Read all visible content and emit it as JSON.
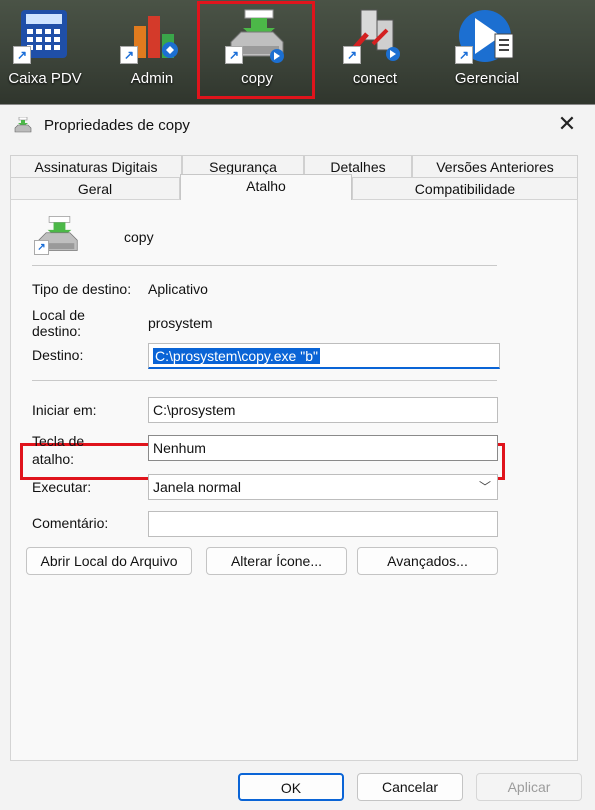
{
  "desktop": {
    "icons": [
      {
        "label": "Caixa PDV",
        "icon": "cash-register-icon"
      },
      {
        "label": "Admin",
        "icon": "admin-chart-icon"
      },
      {
        "label": "copy",
        "icon": "copy-app-icon"
      },
      {
        "label": "conect",
        "icon": "conect-app-icon"
      },
      {
        "label": "Gerencial",
        "icon": "gerencial-app-icon"
      }
    ]
  },
  "dialog": {
    "title": "Propriedades de copy",
    "close": "✕",
    "tabs_row1": [
      "Assinaturas Digitais",
      "Segurança",
      "Detalhes",
      "Versões Anteriores"
    ],
    "tabs_row2": [
      "Geral",
      "Atalho",
      "Compatibilidade"
    ],
    "active_tab": "Atalho",
    "app_name": "copy",
    "tipo_label": "Tipo de destino:",
    "tipo_value": "Aplicativo",
    "local_label1": "Local de",
    "local_label2": "destino:",
    "local_value": "prosystem",
    "destino_label": "Destino:",
    "destino_value": "C:\\prosystem\\copy.exe \"b\"",
    "iniciar_label": "Iniciar em:",
    "iniciar_value": "C:\\prosystem",
    "tecla_label1": "Tecla de",
    "tecla_label2": "atalho:",
    "tecla_value": "Nenhum",
    "executar_label": "Executar:",
    "executar_value": "Janela normal",
    "comentario_label": "Comentário:",
    "comentario_value": "",
    "btn_abrir": "Abrir Local do Arquivo",
    "btn_alterar": "Alterar Ícone...",
    "btn_avancados": "Avançados...",
    "btn_ok": "OK",
    "btn_cancelar": "Cancelar",
    "btn_aplicar": "Aplicar"
  },
  "colors": {
    "highlight": "#e0141c",
    "selection": "#0a64d6"
  }
}
